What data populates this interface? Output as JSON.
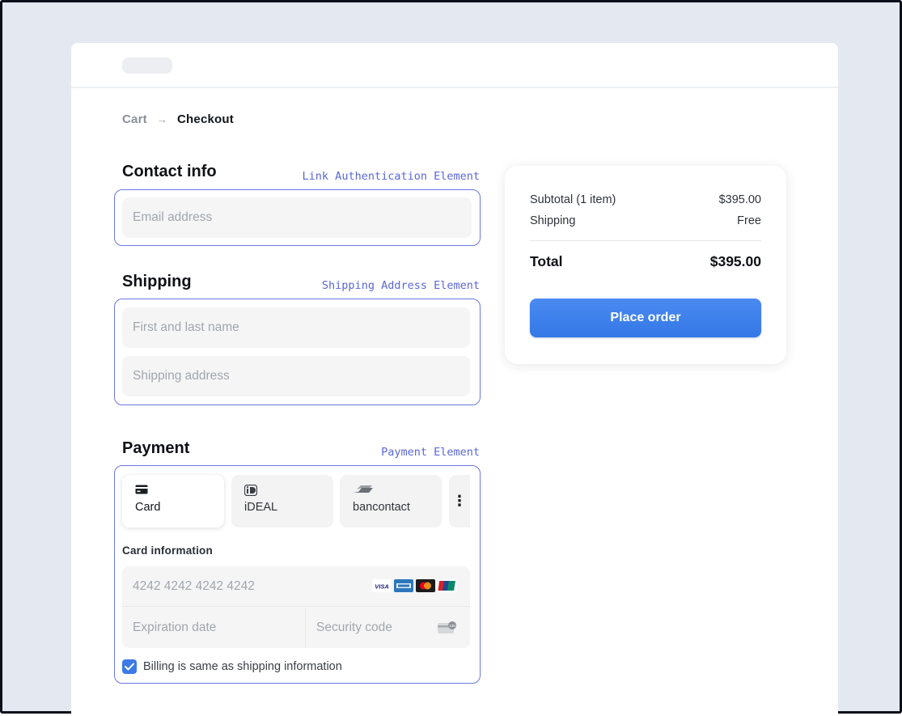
{
  "breadcrumb": {
    "cart": "Cart",
    "checkout": "Checkout"
  },
  "contact": {
    "title": "Contact info",
    "element_label": "Link Authentication Element",
    "email_placeholder": "Email address"
  },
  "shipping": {
    "title": "Shipping",
    "element_label": "Shipping Address Element",
    "name_placeholder": "First and last name",
    "address_placeholder": "Shipping address"
  },
  "payment": {
    "title": "Payment",
    "element_label": "Payment Element",
    "tabs": [
      {
        "label": "Card",
        "icon": "card-icon",
        "active": true
      },
      {
        "label": "iDEAL",
        "icon": "ideal-icon",
        "active": false
      },
      {
        "label": "bancontact",
        "icon": "bancontact-icon",
        "active": false
      }
    ],
    "more_icon": "more-vertical-icon",
    "card_info_label": "Card information",
    "card_number_placeholder": "4242 4242 4242 4242",
    "card_brands": [
      "VISA",
      "American Express",
      "Mastercard",
      "UnionPay"
    ],
    "expiration_placeholder": "Expiration date",
    "security_placeholder": "Security code",
    "billing_label": "Billing is same as shipping information",
    "billing_checked": true
  },
  "summary": {
    "subtotal_label": "Subtotal (1 item)",
    "subtotal_value": "$395.00",
    "shipping_label": "Shipping",
    "shipping_value": "Free",
    "total_label": "Total",
    "total_value": "$395.00",
    "place_order": "Place order"
  },
  "colors": {
    "background": "#e4e8f0",
    "accent": "#3c7ae8",
    "element_outline": "#6b78e0"
  }
}
